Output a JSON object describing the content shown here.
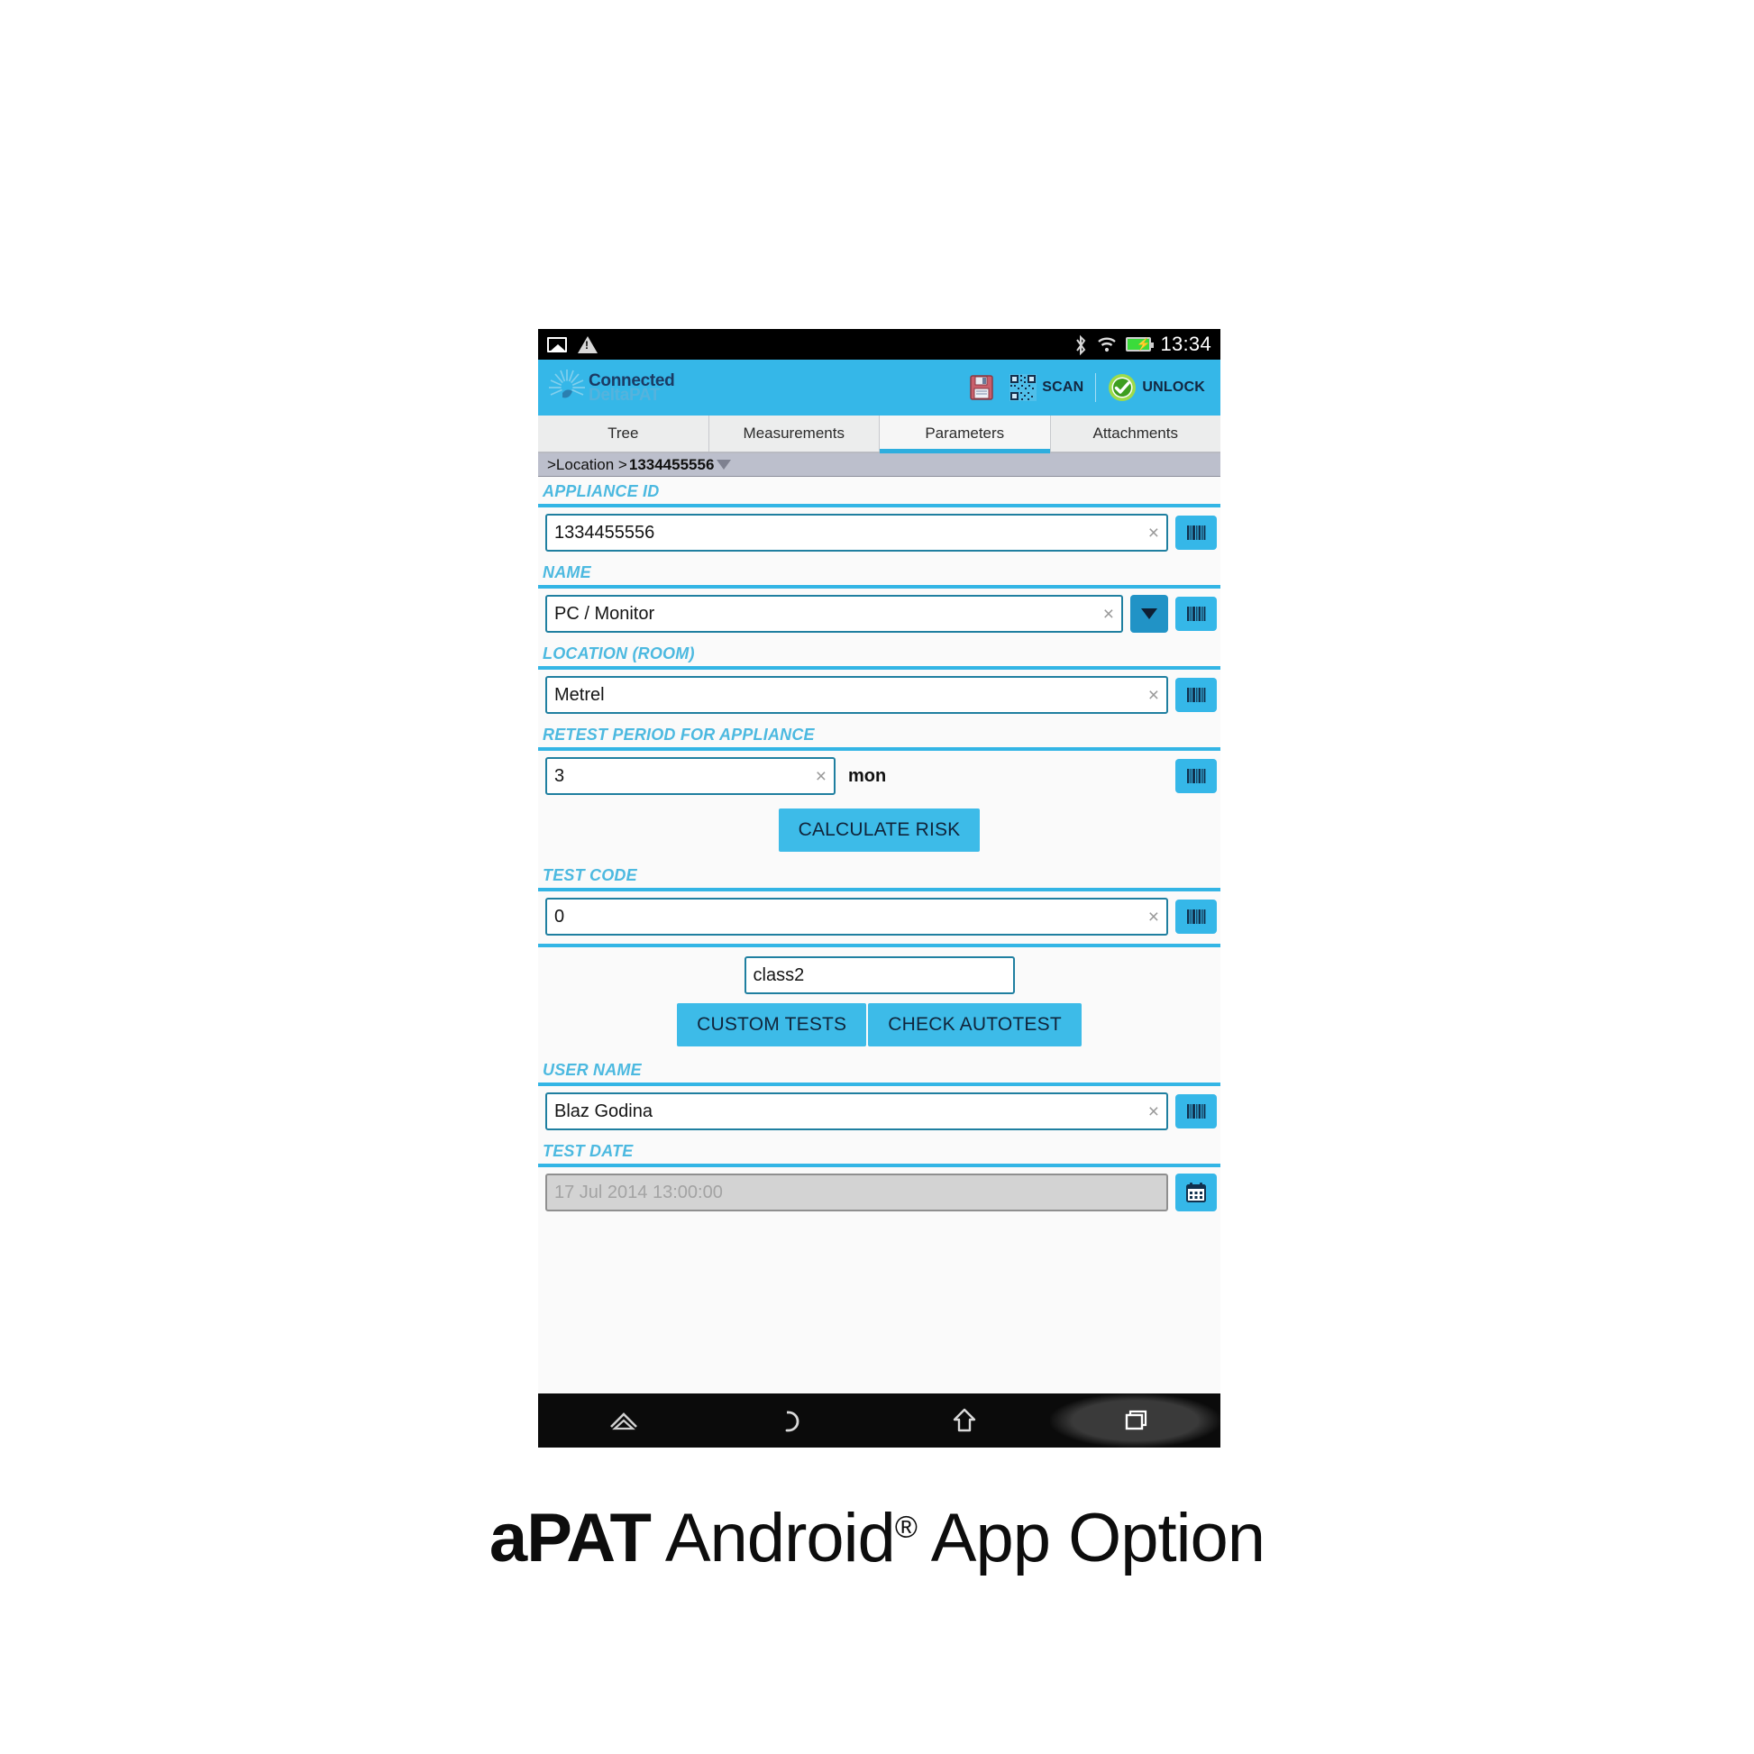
{
  "caption": {
    "brand": "aPAT",
    "rest": " Android",
    "reg": "®",
    "tail": " App Option"
  },
  "statusbar": {
    "icons_left": [
      "photo-icon",
      "warning-icon"
    ],
    "icons_right": [
      "bluetooth-icon",
      "wifi-icon",
      "battery-charging-icon"
    ],
    "time": "13:34"
  },
  "appbar": {
    "logo_line1": "Connected",
    "logo_line2": "DeltaPAT",
    "save_icon": "save-icon",
    "scan_icon": "qr-code-icon",
    "scan_label": "SCAN",
    "unlock_icon": "check-circle-icon",
    "unlock_label": "UNLOCK",
    "accent": "#35b7e8"
  },
  "tabs": [
    {
      "label": "Tree",
      "active": false
    },
    {
      "label": "Measurements",
      "active": false
    },
    {
      "label": "Parameters",
      "active": true
    },
    {
      "label": "Attachments",
      "active": false
    }
  ],
  "breadcrumb": {
    "prefix": ">Location > ",
    "id": "1334455556",
    "caret": "caret-down-icon"
  },
  "form": {
    "appliance_id": {
      "label": "APPLIANCE ID",
      "value": "1334455556",
      "placeholder": "Appliance ID",
      "clear": "×",
      "barcode_icon": "barcode-icon"
    },
    "name": {
      "label": "NAME",
      "value": "PC / Monitor",
      "placeholder": "Name",
      "clear": "×",
      "dropdown_icon": "chevron-down-icon",
      "barcode_icon": "barcode-icon"
    },
    "location": {
      "label": "LOCATION (ROOM)",
      "value": "Metrel",
      "placeholder": "Location",
      "clear": "×",
      "barcode_icon": "barcode-icon"
    },
    "retest": {
      "label": "RETEST PERIOD FOR APPLIANCE",
      "value": "3",
      "placeholder": "Period",
      "clear": "×",
      "unit": "mon",
      "barcode_icon": "barcode-icon"
    },
    "calculate_risk_label": "CALCULATE RISK",
    "test_code": {
      "label": "TEST CODE",
      "value": "0",
      "placeholder": "Test code",
      "clear": "×",
      "barcode_icon": "barcode-icon"
    },
    "class": {
      "value": "class2",
      "placeholder": "class"
    },
    "custom_tests_label": "CUSTOM TESTS",
    "check_autotest_label": "CHECK AUTOTEST",
    "user_name": {
      "label": "USER NAME",
      "value": "Blaz Godina",
      "placeholder": "User name",
      "clear": "×",
      "barcode_icon": "barcode-icon"
    },
    "test_date": {
      "label": "TEST DATE",
      "value": "17 Jul 2014 13:00:00",
      "placeholder": "17 Jul 2014 13:00:00",
      "calendar_icon": "calendar-icon"
    }
  },
  "navbar": {
    "items": [
      "collapse-icon",
      "back-icon",
      "home-icon",
      "recents-icon"
    ]
  }
}
